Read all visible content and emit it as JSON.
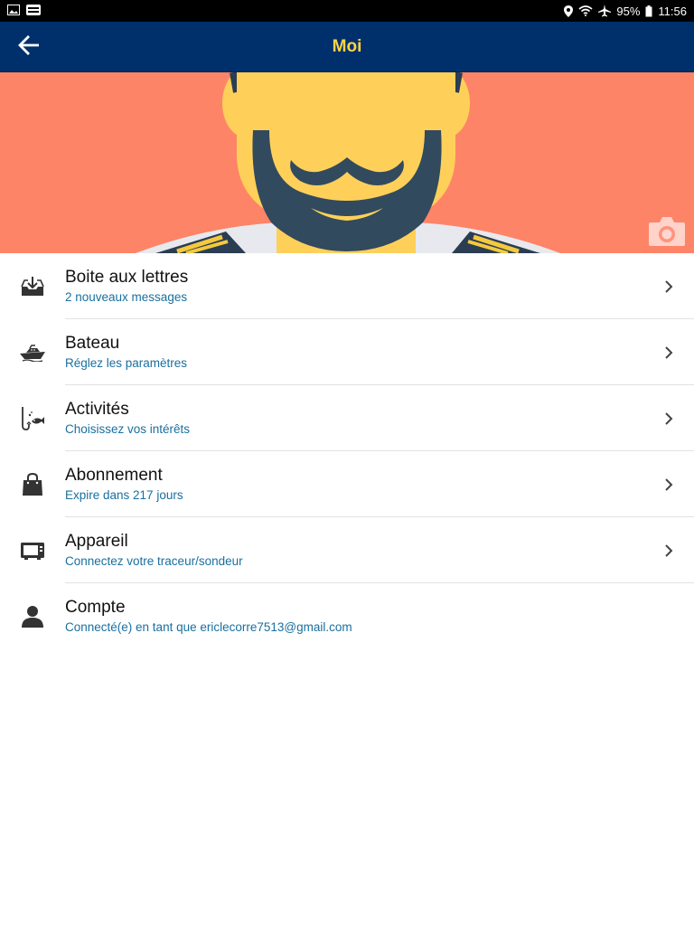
{
  "status_bar": {
    "battery": "95%",
    "time": "11:56",
    "icons": [
      "gallery-icon",
      "app-notification-icon",
      "location-icon",
      "wifi-icon",
      "airplane-icon",
      "battery-icon"
    ]
  },
  "app_bar": {
    "title": "Moi",
    "back_icon": "arrow-left-icon",
    "colors": {
      "background": "#00306b",
      "title": "#ffd34a"
    }
  },
  "hero": {
    "background_color": "#fe8467",
    "camera_icon": "camera-icon"
  },
  "menu": {
    "items": [
      {
        "title": "Boite aux lettres",
        "subtitle": "2 nouveaux messages",
        "icon": "inbox-icon",
        "chevron": true
      },
      {
        "title": "Bateau",
        "subtitle": "Réglez les paramètres",
        "icon": "boat-icon",
        "chevron": true
      },
      {
        "title": "Activités",
        "subtitle": "Choisissez vos intérêts",
        "icon": "fishing-icon",
        "chevron": true
      },
      {
        "title": "Abonnement",
        "subtitle": "Expire dans 217 jours",
        "icon": "shopping-bag-icon",
        "chevron": true
      },
      {
        "title": "Appareil",
        "subtitle": "Connectez votre traceur/sondeur",
        "icon": "device-icon",
        "chevron": true
      },
      {
        "title": "Compte",
        "subtitle": "Connecté(e) en tant que ericlecorre7513@gmail.com",
        "icon": "person-icon",
        "chevron": false
      }
    ],
    "colors": {
      "title": "#111111",
      "subtitle": "#1a6f9e"
    }
  }
}
